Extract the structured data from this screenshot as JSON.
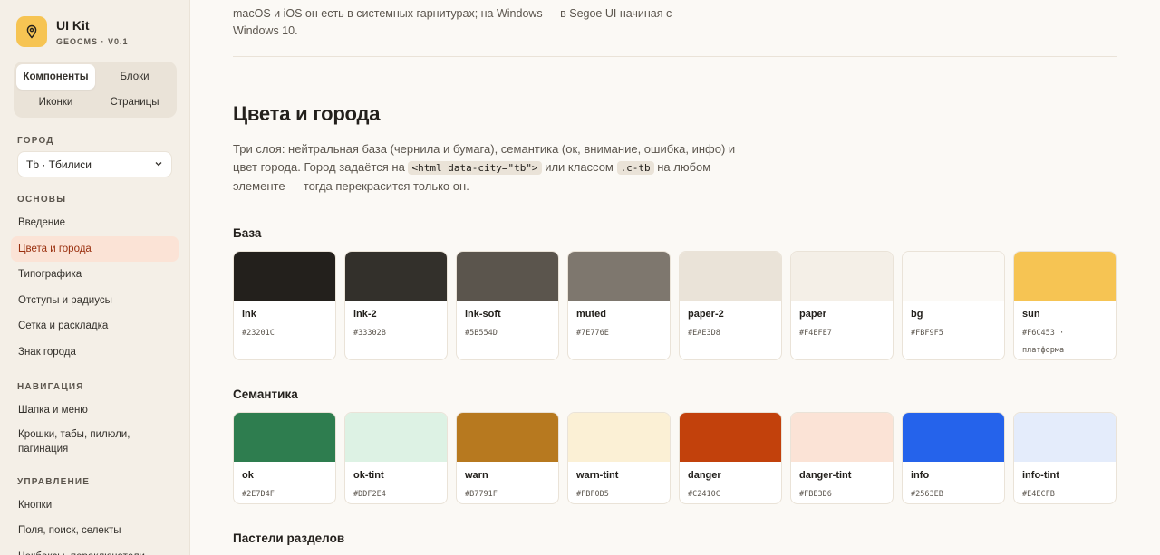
{
  "brand": {
    "title": "UI Kit",
    "subtitle": "GEOCMS · V0.1",
    "logo_icon": "map-pin-icon"
  },
  "segmented": [
    "Компоненты",
    "Блоки",
    "Иконки",
    "Страницы"
  ],
  "city": {
    "label": "ГОРОД",
    "value": "Tb · Тбилиси"
  },
  "nav": {
    "basics_label": "ОСНОВЫ",
    "basics": [
      "Введение",
      "Цвета и города",
      "Типографика",
      "Отступы и радиусы",
      "Сетка и раскладка",
      "Знак города"
    ],
    "navigation_label": "НАВИГАЦИЯ",
    "navigation": [
      "Шапка и меню",
      "Крошки, табы, пилюли, пагинация"
    ],
    "control_label": "УПРАВЛЕНИЕ",
    "control": [
      "Кнопки",
      "Поля, поиск, селекты",
      "Чекбоксы, переключатели"
    ]
  },
  "intro_tail": "macOS и iOS он есть в системных гарнитурах; на Windows — в Segoe UI начиная с Windows 10.",
  "section": {
    "title": "Цвета и города",
    "lead_1": "Три слоя: нейтральная база (чернила и бумага), семантика (ок, внимание, ошибка, инфо) и цвет города. Город задаётся на",
    "code_1": "<html data-city=\"tb\">",
    "lead_2": "или классом",
    "code_2": ".c-tb",
    "lead_3": "на любом элементе — тогда перекрасится только он."
  },
  "base": {
    "title": "База",
    "swatches": [
      {
        "name": "ink",
        "hex": "#23201C",
        "color": "#23201C"
      },
      {
        "name": "ink-2",
        "hex": "#33302B",
        "color": "#33302B"
      },
      {
        "name": "ink-soft",
        "hex": "#5B554D",
        "color": "#5B554D"
      },
      {
        "name": "muted",
        "hex": "#7E776E",
        "color": "#7E776E"
      },
      {
        "name": "paper-2",
        "hex": "#EAE3D8",
        "color": "#EAE3D8"
      },
      {
        "name": "paper",
        "hex": "#F4EFE7",
        "color": "#F4EFE7"
      },
      {
        "name": "bg",
        "hex": "#FBF9F5",
        "color": "#FBF9F5"
      },
      {
        "name": "sun",
        "hex": "#F6C453 · платформа",
        "color": "#F6C453"
      }
    ]
  },
  "semantic": {
    "title": "Семантика",
    "swatches": [
      {
        "name": "ok",
        "hex": "#2E7D4F",
        "color": "#2E7D4F"
      },
      {
        "name": "ok-tint",
        "hex": "#DDF2E4",
        "color": "#DDF2E4"
      },
      {
        "name": "warn",
        "hex": "#B7791F",
        "color": "#B7791F"
      },
      {
        "name": "warn-tint",
        "hex": "#FBF0D5",
        "color": "#FBF0D5"
      },
      {
        "name": "danger",
        "hex": "#C2410C",
        "color": "#C2410C"
      },
      {
        "name": "danger-tint",
        "hex": "#FBE3D6",
        "color": "#FBE3D6"
      },
      {
        "name": "info",
        "hex": "#2563EB",
        "color": "#2563EB"
      },
      {
        "name": "info-tint",
        "hex": "#E4ECFB",
        "color": "#E4ECFB"
      }
    ]
  },
  "pastels": {
    "title": "Пастели разделов"
  }
}
